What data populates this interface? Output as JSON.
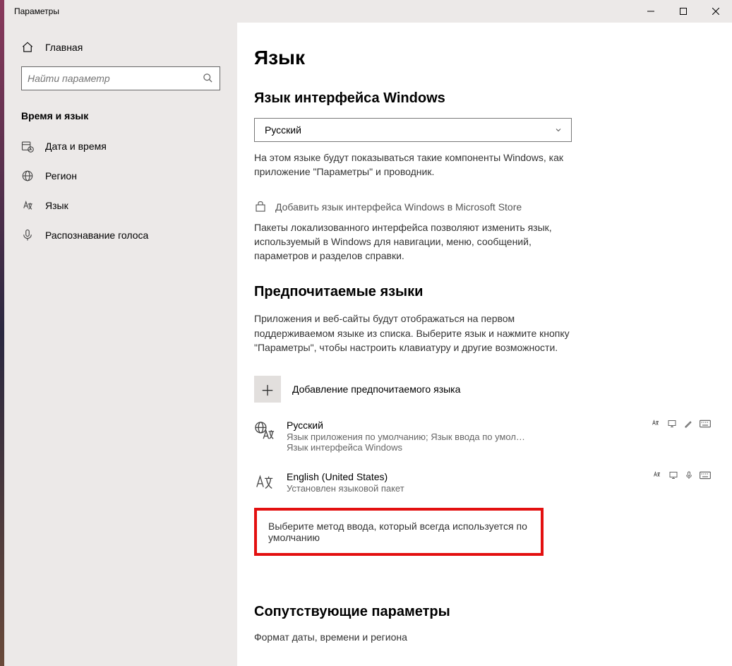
{
  "titlebar": {
    "title": "Параметры"
  },
  "sidebar": {
    "home_label": "Главная",
    "search_placeholder": "Найти параметр",
    "section_title": "Время и язык",
    "items": [
      {
        "label": "Дата и время"
      },
      {
        "label": "Регион"
      },
      {
        "label": "Язык"
      },
      {
        "label": "Распознавание голоса"
      }
    ]
  },
  "main": {
    "page_title": "Язык",
    "display_section": {
      "heading": "Язык интерфейса Windows",
      "selected": "Русский",
      "description": "На этом языке будут показываться такие компоненты Windows, как приложение \"Параметры\" и проводник.",
      "store_link": "Добавить язык интерфейса Windows в Microsoft Store",
      "store_desc": "Пакеты локализованного интерфейса позволяют изменить язык, используемый в Windows для навигации, меню, сообщений, параметров и разделов справки."
    },
    "preferred_section": {
      "heading": "Предпочитаемые языки",
      "description": "Приложения и веб-сайты будут отображаться на первом поддерживаемом языке из списка. Выберите язык и нажмите кнопку \"Параметры\", чтобы настроить клавиатуру и другие возможности.",
      "add_label": "Добавление предпочитаемого языка",
      "languages": [
        {
          "name": "Русский",
          "subtitle": "Язык приложения по умолчанию; Язык ввода по умол…",
          "subtitle2": "Язык интерфейса Windows"
        },
        {
          "name": "English (United States)",
          "subtitle": "Установлен языковой пакет",
          "subtitle2": ""
        }
      ],
      "default_input_link": "Выберите метод ввода, который всегда используется по умолчанию"
    },
    "related_section": {
      "heading": "Сопутствующие параметры",
      "link": "Формат даты, времени и региона"
    }
  }
}
